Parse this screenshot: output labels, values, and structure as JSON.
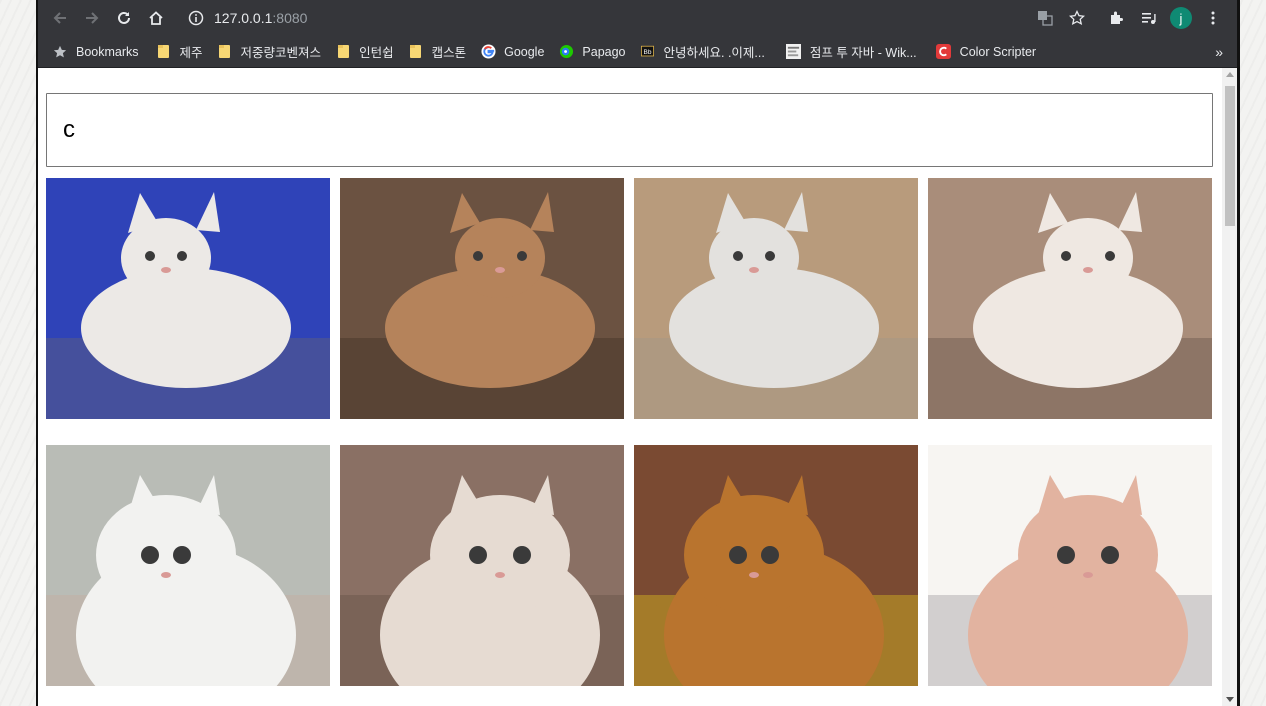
{
  "browser": {
    "url_host": "127.0.0.1",
    "url_port": ":8080",
    "avatar_letter": "j"
  },
  "bookmarks": [
    {
      "label": "Bookmarks",
      "icon": "star-icon"
    },
    {
      "label": "제주",
      "icon": "folder-icon"
    },
    {
      "label": "저중량코벤져스",
      "icon": "folder-icon"
    },
    {
      "label": "인턴쉽",
      "icon": "folder-icon"
    },
    {
      "label": "캡스톤",
      "icon": "folder-icon"
    },
    {
      "label": "Google",
      "icon": "google-icon"
    },
    {
      "label": "Papago",
      "icon": "papago-icon"
    },
    {
      "label": "안녕하세요. .이제...",
      "icon": "bb-icon"
    },
    {
      "label": "점프 투 자바 - Wik...",
      "icon": "wikidocs-icon"
    },
    {
      "label": "Color Scripter",
      "icon": "color-scripter-icon"
    }
  ],
  "bookmarks_overflow": "»",
  "search": {
    "value": "c"
  },
  "cats": [
    {
      "icon": "cat-photo-ragdoll",
      "bg": "#2f43b8",
      "fur": "#ece9e6",
      "accent": "#6f6a67"
    },
    {
      "icon": "cat-photo-abyssinian-dusk",
      "bg": "#6b5241",
      "fur": "#b5835b",
      "accent": "#3a2a20"
    },
    {
      "icon": "cat-photo-white-on-floor",
      "bg": "#b89b7c",
      "fur": "#e3e1de",
      "accent": "#9c948b"
    },
    {
      "icon": "cat-photo-himalayan",
      "bg": "#a98d7a",
      "fur": "#efe8e2",
      "accent": "#5a4a42"
    },
    {
      "icon": "cat-photo-white-sitting",
      "bg": "#b9bcb6",
      "fur": "#f2f2f0",
      "accent": "#c9a89a"
    },
    {
      "icon": "cat-photo-exotic-closeup",
      "bg": "#8a7064",
      "fur": "#e6dbd2",
      "accent": "#5c4a3e"
    },
    {
      "icon": "cat-photo-orange-yellow",
      "bg": "#7a4a32",
      "fur": "#b9742e",
      "accent": "#f4d719"
    },
    {
      "icon": "cat-photo-sphynx",
      "bg": "#f7f5f2",
      "fur": "#e2b3a0",
      "accent": "#8c8a8e"
    }
  ]
}
